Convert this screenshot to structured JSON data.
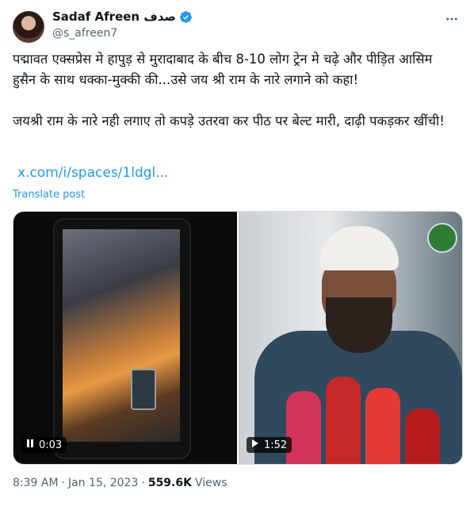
{
  "author": {
    "display_name": "Sadaf Afreen صدف",
    "handle": "@s_afreen7",
    "verified": true,
    "verified_color": "#1d9bf0"
  },
  "tweet": {
    "text_para1": "पद्मावत एक्सप्रेस मे हापुड़ से मुरादाबाद के बीच 8-10 लोग ट्रेन मे चढ़े और पीड़ित आसिम हुसैन के साथ धक्का-मुक्की की...उसे जय श्री राम के नारे लगाने को कहा!",
    "text_para2": "जयश्री राम के नारे नही लगाए तो कपड़े उतरवा कर पीठ पर बेल्ट मारी, दाढ़ी पकड़कर खींची!",
    "link": "x.com/i/spaces/1ldgl...",
    "translate_label": "Translate post"
  },
  "media": [
    {
      "duration": "0:03",
      "control_icon": "pause-icon"
    },
    {
      "duration": "1:52",
      "control_icon": "play-icon"
    }
  ],
  "meta": {
    "time": "8:39 AM",
    "date": "Jan 15, 2023",
    "separator": "·",
    "views_count": "559.6K",
    "views_label": "Views"
  },
  "colors": {
    "link": "#1d9bf0",
    "text": "#0f1419",
    "secondary": "#536471",
    "border": "#cfd9de"
  }
}
